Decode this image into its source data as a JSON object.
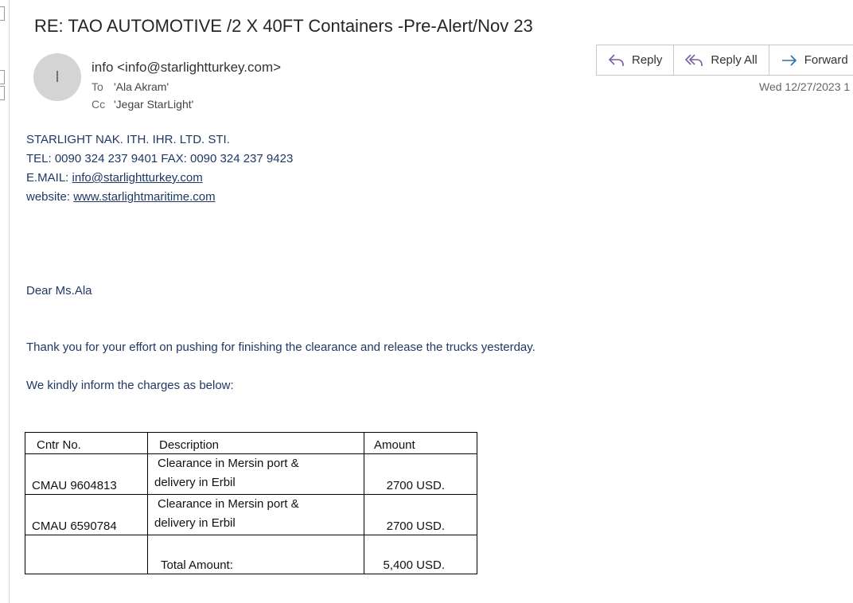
{
  "email": {
    "subject": "RE: TAO AUTOMOTIVE /2 X 40FT Containers -Pre-Alert/Nov 23",
    "avatar_initial": "I",
    "from": "info <info@starlightturkey.com>",
    "to_label": "To",
    "to": "'Ala Akram'",
    "cc_label": "Cc",
    "cc": "'Jegar StarLight'",
    "date": "Wed 12/27/2023 1"
  },
  "actions": {
    "reply": "Reply",
    "reply_all": "Reply All",
    "forward": "Forward"
  },
  "body": {
    "company": "STARLIGHT NAK. ITH. IHR. LTD. STI.",
    "tel": "TEL: 0090 324 237 9401 FAX: 0090 324 237 9423",
    "email_label": "E.MAIL: ",
    "email_link": "info@starlightturkey.com",
    "website_label": "website: ",
    "website_link": "www.starlightmaritime.com",
    "greeting": "Dear Ms.Ala",
    "para1": "Thank you for your effort on pushing for finishing the clearance and release the trucks yesterday.",
    "para2": "We kindly inform the charges as below:"
  },
  "table": {
    "headers": [
      "Cntr No.",
      "Description",
      "Amount"
    ],
    "rows": [
      {
        "cntr": "CMAU 9604813",
        "desc_line1": "Clearance in Mersin port &",
        "desc_line2": "delivery in Erbil",
        "amount": "2700 USD."
      },
      {
        "cntr": "CMAU 6590784",
        "desc_line1": "Clearance in Mersin port &",
        "desc_line2": "delivery in Erbil",
        "amount": "2700 USD."
      }
    ],
    "total_label": "Total Amount:",
    "total_amount": "5,400 USD."
  },
  "colors": {
    "body_text": "#1f3864",
    "accent_icon": "#7a5ca8",
    "forward_icon": "#2b6cb0"
  }
}
